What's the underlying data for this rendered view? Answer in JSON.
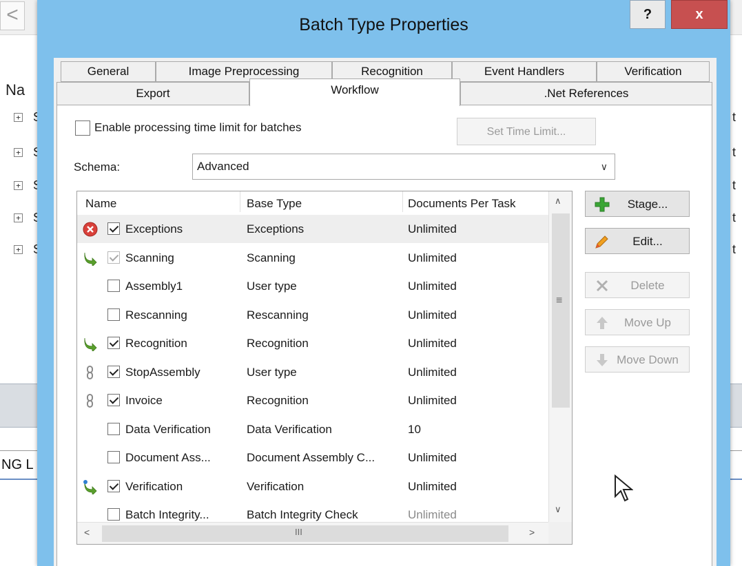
{
  "background": {
    "back_glyph": "<",
    "column_header_fragment": "Na",
    "tree_rows": [
      {
        "expander": "+",
        "text": "S"
      },
      {
        "expander": "+",
        "text": "S"
      },
      {
        "expander": "+",
        "text": "S"
      },
      {
        "expander": "+",
        "text": "S"
      },
      {
        "expander": "+",
        "text": "S"
      }
    ],
    "right_fragment": "t",
    "tab_fragment": "NG L"
  },
  "dialog": {
    "title": "Batch Type Properties",
    "help_label": "?",
    "close_label": "x",
    "tabs_row1": [
      "General",
      "Image Preprocessing",
      "Recognition",
      "Event Handlers",
      "Verification"
    ],
    "tabs_row2": [
      "Export",
      "Workflow",
      ".Net References"
    ],
    "active_tab": "Workflow",
    "enable_time_limit": {
      "label": "Enable processing time limit for batches",
      "checked": false
    },
    "set_time_limit_label": "Set Time Limit...",
    "schema": {
      "label": "Schema:",
      "value": "Advanced"
    },
    "list": {
      "columns": [
        "Name",
        "Base Type",
        "Documents Per Task"
      ],
      "rows": [
        {
          "icon": "error-icon",
          "checked": true,
          "name": "Exceptions",
          "base_type": "Exceptions",
          "docs": "Unlimited",
          "selected": true
        },
        {
          "icon": "arrow-right-green-icon",
          "checked": true,
          "dim": true,
          "name": "Scanning",
          "base_type": "Scanning",
          "docs": "Unlimited"
        },
        {
          "icon": "",
          "checked": false,
          "name": "Assembly1",
          "base_type": "User type",
          "docs": "Unlimited"
        },
        {
          "icon": "",
          "checked": false,
          "name": "Rescanning",
          "base_type": "Rescanning",
          "docs": "Unlimited"
        },
        {
          "icon": "arrow-right-green-icon",
          "checked": true,
          "name": "Recognition",
          "base_type": "Recognition",
          "docs": "Unlimited"
        },
        {
          "icon": "link-icon",
          "checked": true,
          "name": "StopAssembly",
          "base_type": "User type",
          "docs": "Unlimited"
        },
        {
          "icon": "link-icon",
          "checked": true,
          "name": "Invoice",
          "base_type": "Recognition",
          "docs": "Unlimited"
        },
        {
          "icon": "",
          "checked": false,
          "name": "Data Verification",
          "base_type": "Data Verification",
          "docs": "10"
        },
        {
          "icon": "",
          "checked": false,
          "name": "Document Ass...",
          "base_type": "Document Assembly C...",
          "docs": "Unlimited"
        },
        {
          "icon": "arrow-right-green-blue-icon",
          "checked": true,
          "name": "Verification",
          "base_type": "Verification",
          "docs": "Unlimited"
        },
        {
          "icon": "",
          "checked": false,
          "name": "Batch Integrity...",
          "base_type": "Batch Integrity Check",
          "docs": "Unlimited",
          "docs_dim": true
        }
      ]
    },
    "side_buttons": [
      {
        "label": "Stage...",
        "icon": "plus-icon",
        "enabled": true
      },
      {
        "label": "Edit...",
        "icon": "pencil-icon",
        "enabled": true
      },
      {
        "label": "Delete",
        "icon": "delete-x-icon",
        "enabled": false
      },
      {
        "label": "Move Up",
        "icon": "arrow-up-icon",
        "enabled": false
      },
      {
        "label": "Move Down",
        "icon": "arrow-down-icon",
        "enabled": false
      }
    ],
    "colors": {
      "frame": "#7ec0ec",
      "close": "#c75050",
      "client": "#f0f0f0",
      "plus_green": "#3aa635",
      "error_red": "#d9403a",
      "arrow_green": "#5aa02c"
    }
  }
}
